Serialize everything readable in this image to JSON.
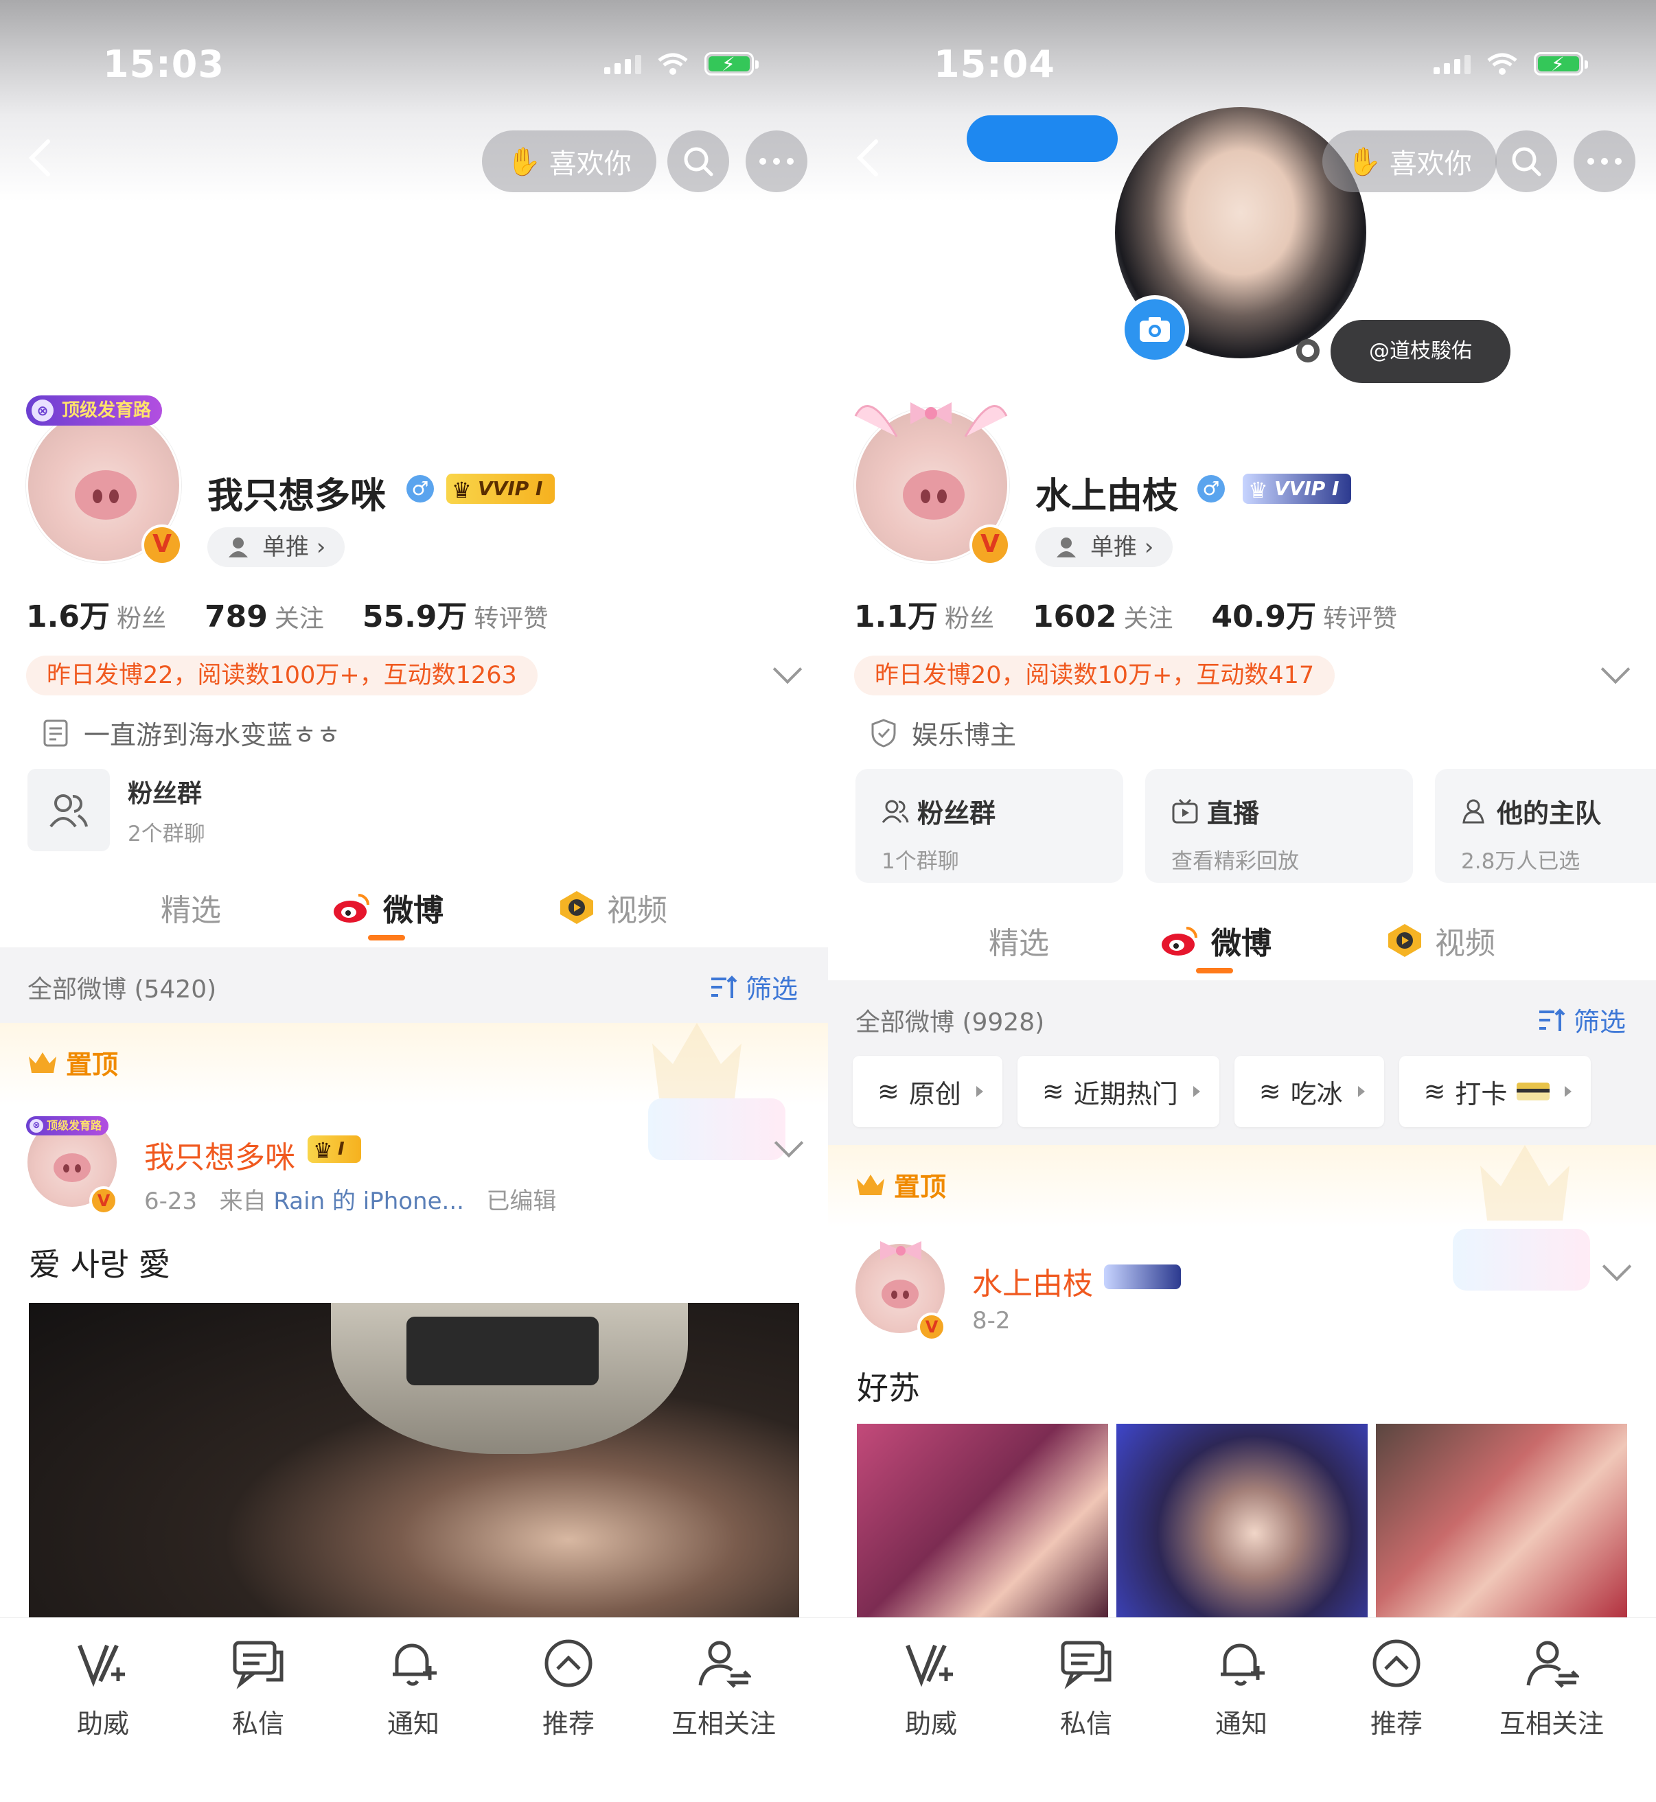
{
  "left": {
    "status": {
      "time": "15:03"
    },
    "header": {
      "like_label": "喜欢你"
    },
    "profile": {
      "rank_tag": "顶级发育路",
      "name": "我只想多咪",
      "gender_icon": "male-icon",
      "vip_label": "VVIP I",
      "danzhui": "单推",
      "stats": [
        {
          "num": "1.6万",
          "label": "粉丝"
        },
        {
          "num": "789",
          "label": "关注"
        },
        {
          "num": "55.9万",
          "label": "转评赞"
        }
      ],
      "activity": "昨日发博22，阅读数100万+，互动数1263",
      "bio": "一直游到海水变蓝ㅎㅎ",
      "fans_group": {
        "title": "粉丝群",
        "sub": "2个群聊"
      }
    },
    "tabs": [
      "精选",
      "微博",
      "视频"
    ],
    "filter": {
      "all": "全部微博 (5420)",
      "filter_label": "筛选"
    },
    "pinned": "置顶",
    "post": {
      "name": "我只想多咪",
      "vip": "I",
      "date": "6-23",
      "from_prefix": "来自",
      "source": "Rain 的 iPhone...",
      "edited": "已编辑",
      "text": "爱 사랑 愛"
    }
  },
  "right": {
    "status": {
      "time": "15:04"
    },
    "header": {
      "like_label": "喜欢你"
    },
    "at_tag": "@道枝駿佑",
    "profile": {
      "name": "水上由枝",
      "gender_icon": "male-icon",
      "vip_label": "VVIP I",
      "danzhui": "单推",
      "stats": [
        {
          "num": "1.1万",
          "label": "粉丝"
        },
        {
          "num": "1602",
          "label": "关注"
        },
        {
          "num": "40.9万",
          "label": "转评赞"
        }
      ],
      "activity": "昨日发博20，阅读数10万+，互动数417",
      "bio": "娱乐博主",
      "cards": [
        {
          "title": "粉丝群",
          "sub": "1个群聊"
        },
        {
          "title": "直播",
          "sub": "查看精彩回放"
        },
        {
          "title": "他的主队",
          "sub": "2.8万人已选"
        }
      ]
    },
    "tabs": [
      "精选",
      "微博",
      "视频"
    ],
    "filter": {
      "all": "全部微博 (9928)",
      "filter_label": "筛选"
    },
    "chips": [
      "原创",
      "近期热门",
      "吃冰",
      "打卡"
    ],
    "pinned": "置顶",
    "post": {
      "name": "水上由枝",
      "date": "8-2",
      "text": "好苏"
    }
  },
  "bottom_bar": [
    "助威",
    "私信",
    "通知",
    "推荐",
    "互相关注"
  ],
  "colors": {
    "accent_orange": "#f0591f",
    "link_blue": "#3d77d6",
    "tab_underline": "#ff7a1a"
  }
}
